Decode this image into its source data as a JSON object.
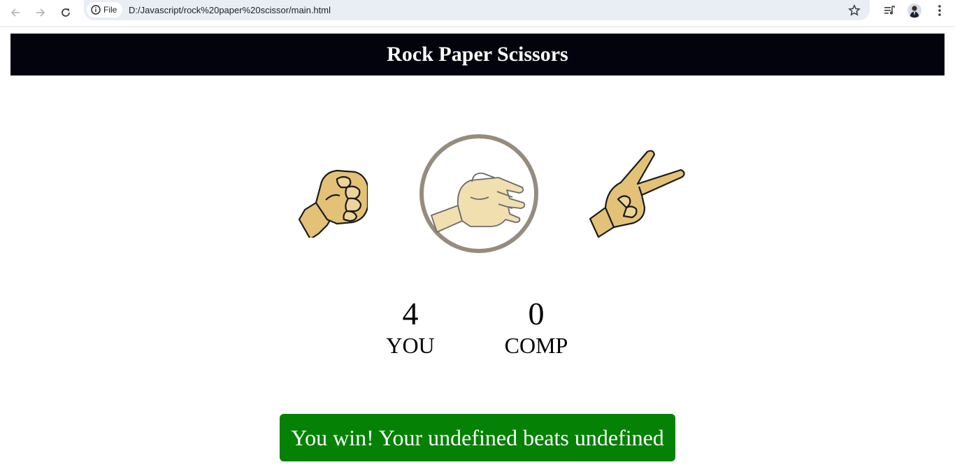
{
  "browser": {
    "security_chip": "File",
    "url": "D:/Javascript/rock%20paper%20scissor/main.html"
  },
  "header": {
    "title": "Rock Paper Scissors"
  },
  "choices": [
    {
      "id": "rock",
      "icon": "rock-fist-icon",
      "selected": false
    },
    {
      "id": "paper",
      "icon": "paper-open-hand-icon",
      "selected": true
    },
    {
      "id": "scissors",
      "icon": "scissors-v-hand-icon",
      "selected": false
    }
  ],
  "scoreboard": {
    "user": {
      "score": "4",
      "label": "YOU"
    },
    "comp": {
      "score": "0",
      "label": "COMP"
    }
  },
  "message": {
    "text": "You win! Your undefined beats undefined",
    "color": "#058105"
  },
  "colors": {
    "header_bg": "#03030e",
    "hand_skin": "#e3c277",
    "selected_ring": "#968c7e"
  }
}
